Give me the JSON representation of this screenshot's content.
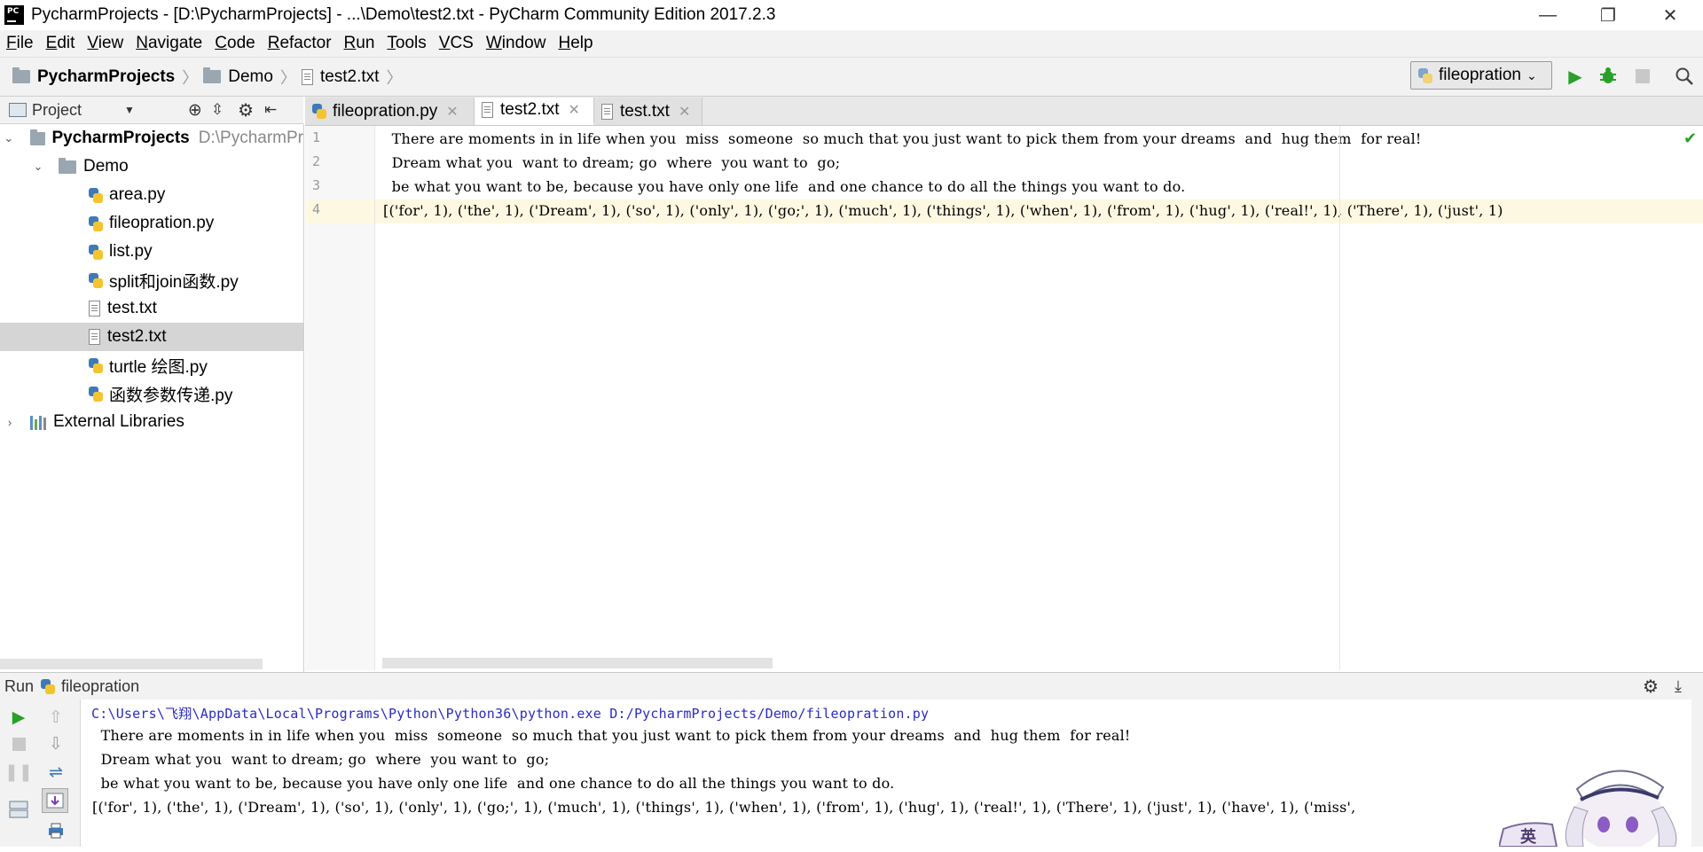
{
  "window": {
    "title": "PycharmProjects - [D:\\PycharmProjects] - ...\\Demo\\test2.txt - PyCharm Community Edition 2017.2.3",
    "controls": {
      "minimize": "—",
      "restore": "❐",
      "close": "✕"
    }
  },
  "menu": [
    "File",
    "Edit",
    "View",
    "Navigate",
    "Code",
    "Refactor",
    "Run",
    "Tools",
    "VCS",
    "Window",
    "Help"
  ],
  "breadcrumbs": [
    "PycharmProjects",
    "Demo",
    "test2.txt"
  ],
  "run_config": {
    "selected": "fileopration"
  },
  "project_panel": {
    "title": "Project",
    "root": {
      "name": "PycharmProjects",
      "path": "D:\\PycharmPr"
    },
    "demo_folder": "Demo",
    "files": [
      "area.py",
      "fileopration.py",
      "list.py",
      "split和join函数.py",
      "test.txt",
      "test2.txt",
      "turtle 绘图.py",
      "函数参数传递.py"
    ],
    "external": "External Libraries"
  },
  "tabs": [
    {
      "label": "fileopration.py",
      "icon": "python-file-icon"
    },
    {
      "label": "test2.txt",
      "icon": "text-file-icon"
    },
    {
      "label": "test.txt",
      "icon": "text-file-icon"
    }
  ],
  "editor": {
    "line_numbers": [
      "1",
      "2",
      "3",
      "4"
    ],
    "lines": [
      "  There are moments in in life when you  miss  someone  so much that you just want to pick them from your dreams  and  hug them  for real!",
      "  Dream what you  want to dream; go  where  you want to  go;",
      "  be what you want to be, because you have only one life  and one chance to do all the things you want to do.",
      "[('for', 1), ('the', 1), ('Dream', 1), ('so', 1), ('only', 1), ('go;', 1), ('much', 1), ('things', 1), ('when', 1), ('from', 1), ('hug', 1), ('real!', 1), ('There', 1), ('just', 1)"
    ]
  },
  "run_panel": {
    "label": "Run",
    "config": "fileopration",
    "console": [
      "C:\\Users\\飞翔\\AppData\\Local\\Programs\\Python\\Python36\\python.exe D:/PycharmProjects/Demo/fileopration.py",
      "  There are moments in in life when you  miss  someone  so much that you just want to pick them from your dreams  and  hug them  for real!",
      "  Dream what you  want to dream; go  where  you want to  go;",
      "  be what you want to be, because you have only one life  and one chance to do all the things you want to do.",
      "[('for', 1), ('the', 1), ('Dream', 1), ('so', 1), ('only', 1), ('go;', 1), ('much', 1), ('things', 1), ('when', 1), ('from', 1), ('hug', 1), ('real!', 1), ('There', 1), ('just', 1), ('have', 1), ('miss',"
    ]
  },
  "ime": {
    "label": "英"
  },
  "colors": {
    "accent_green": "#2aa02a",
    "console_cmd": "#2b2bc4",
    "current_line": "#fdf8e1",
    "selected_row": "#d5d5d5"
  }
}
